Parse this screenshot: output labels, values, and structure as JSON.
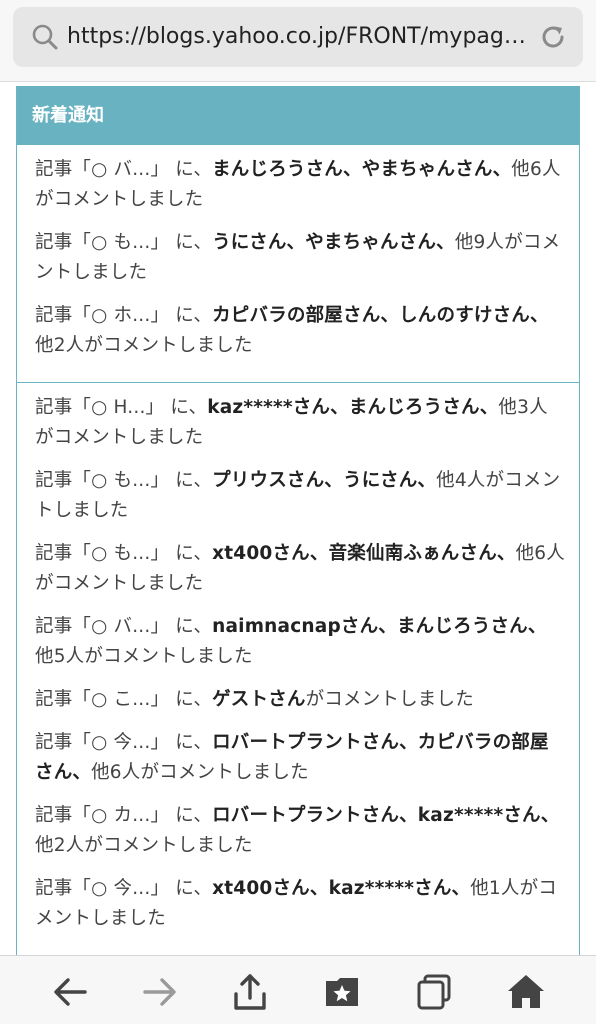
{
  "browser": {
    "url": "https://blogs.yahoo.co.jp/FRONT/mypag…"
  },
  "panel": {
    "title": "新着通知",
    "groups": [
      {
        "items": [
          {
            "pfx": "記事「○ バ...」 に、",
            "names": "まんじろうさん、やまちゃんさん、",
            "tail": "他6人がコメントしました"
          },
          {
            "pfx": "記事「○ も...」 に、",
            "names": "うにさん、やまちゃんさん、",
            "tail": "他9人がコメントしました"
          },
          {
            "pfx": "記事「○ ホ...」 に、",
            "names": "カピバラの部屋さん、しんのすけさん、",
            "tail": "他2人がコメントしました"
          }
        ]
      },
      {
        "items": [
          {
            "pfx": "記事「○ H...」 に、",
            "names": "kaz*****さん、まんじろうさん、",
            "tail": "他3人がコメントしました"
          },
          {
            "pfx": "記事「○ も...」 に、",
            "names": "プリウスさん、うにさん、",
            "tail": "他4人がコメントしました"
          },
          {
            "pfx": "記事「○ も...」 に、",
            "names": "xt400さん、音楽仙南ふぁんさん、",
            "tail": "他6人がコメントしました"
          },
          {
            "pfx": "記事「○ バ...」 に、",
            "names": "naimnacnapさん、まんじろうさん、",
            "tail": "他5人がコメントしました"
          },
          {
            "pfx": "記事「○ こ...」 に、",
            "names": "ゲストさん",
            "tail": "がコメントしました"
          },
          {
            "pfx": "記事「○ 今...」 に、",
            "names": "ロバートプラントさん、カピバラの部屋さん、",
            "tail": "他6人がコメントしました"
          },
          {
            "pfx": "記事「○ カ...」 に、",
            "names": "ロバートプラントさん、kaz*****さん、",
            "tail": "他2人がコメントしました"
          },
          {
            "pfx": "記事「○ 今...」 に、",
            "names": "xt400さん、kaz*****さん、",
            "tail": "他1人がコメントしました"
          }
        ]
      }
    ]
  },
  "toolbar": {
    "icons": [
      "back-icon",
      "forward-icon",
      "share-icon",
      "bookmarks-icon",
      "tabs-icon",
      "home-icon"
    ]
  },
  "colors": {
    "accent": "#68b2c1",
    "border": "#69b5c3",
    "toolbar_icon": "#444444",
    "toolbar_icon_disabled": "#9a9a9a"
  }
}
